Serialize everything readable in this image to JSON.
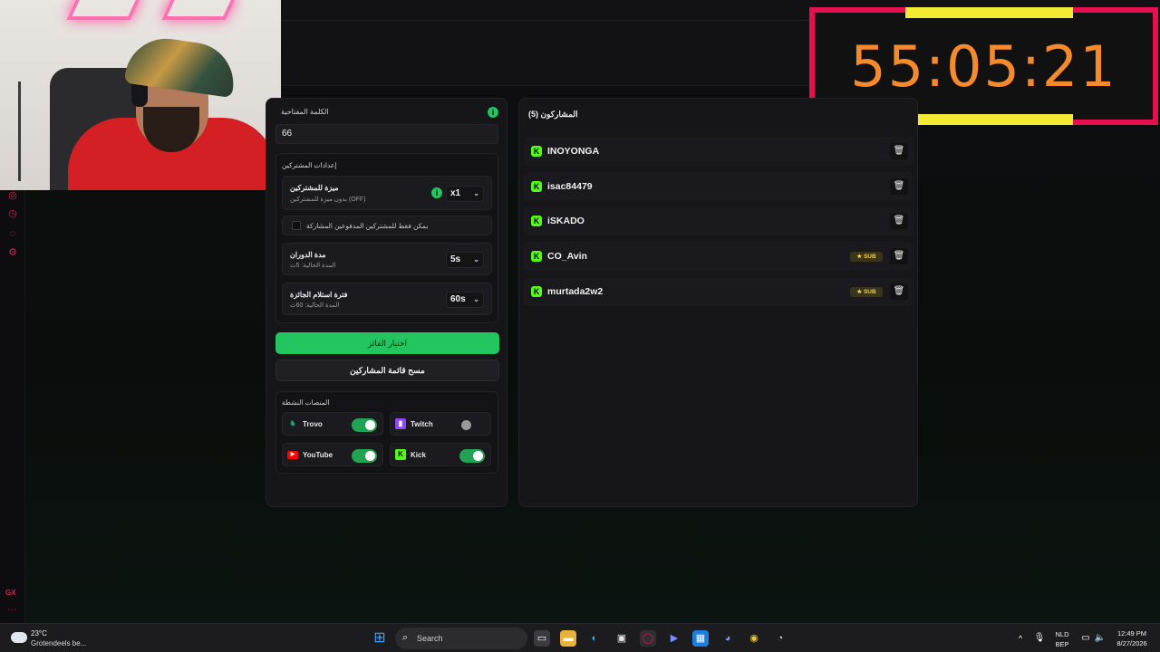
{
  "timer": {
    "display": "55:05:21"
  },
  "keyword": {
    "label": "الكلمة المفتاحية",
    "value": "66"
  },
  "settings": {
    "title": "إعدادات المشتركين",
    "subscriber_bonus": {
      "title": "ميزة للمشتركين",
      "subtitle": "بدون ميزة للمشتركين (OFF)",
      "value": "x1"
    },
    "subs_only_label": "يمكن فقط للمشتركين المدفوعين المشاركة",
    "spin_duration": {
      "title": "مدة الدوران",
      "subtitle": "المدة الحالية: 5ث",
      "value": "5s"
    },
    "claim_period": {
      "title": "فترة استلام الجائزة",
      "subtitle": "المدة الحالية: 60ث",
      "value": "60s"
    }
  },
  "buttons": {
    "pick_winner": "اختيار الفائز",
    "clear_list": "مسح قائمة المشاركين"
  },
  "platforms": {
    "title": "المنصات النشطة",
    "items": [
      {
        "name": "Trovo",
        "enabled": true,
        "color": "#1ba466"
      },
      {
        "name": "Twitch",
        "enabled": false,
        "color": "#9146ff"
      },
      {
        "name": "YouTube",
        "enabled": true,
        "color": "#ff0000"
      },
      {
        "name": "Kick",
        "enabled": true,
        "color": "#53fc18"
      }
    ]
  },
  "participants": {
    "title": "المشاركون (5)",
    "list": [
      {
        "username": "INOYONGA",
        "sub": false
      },
      {
        "username": "isac84479",
        "sub": false
      },
      {
        "username": "iSKADO",
        "sub": false
      },
      {
        "username": "CO_Avin",
        "sub": true
      },
      {
        "username": "murtada2w2",
        "sub": true
      }
    ],
    "sub_badge": "SUB"
  },
  "taskbar": {
    "weather_temp": "23°C",
    "weather_desc": "Grotendeels be...",
    "search_placeholder": "Search",
    "lang_top": "NLD",
    "lang_bottom": "BEP",
    "time": "12:49 PM",
    "date": "8/27/2026"
  },
  "browser": {
    "gx_label": "GX"
  },
  "colors": {
    "accent_green": "#22c55e",
    "kick_green": "#53fc18",
    "timer_frame": "#e5104f",
    "timer_digits": "#f58a2c"
  }
}
